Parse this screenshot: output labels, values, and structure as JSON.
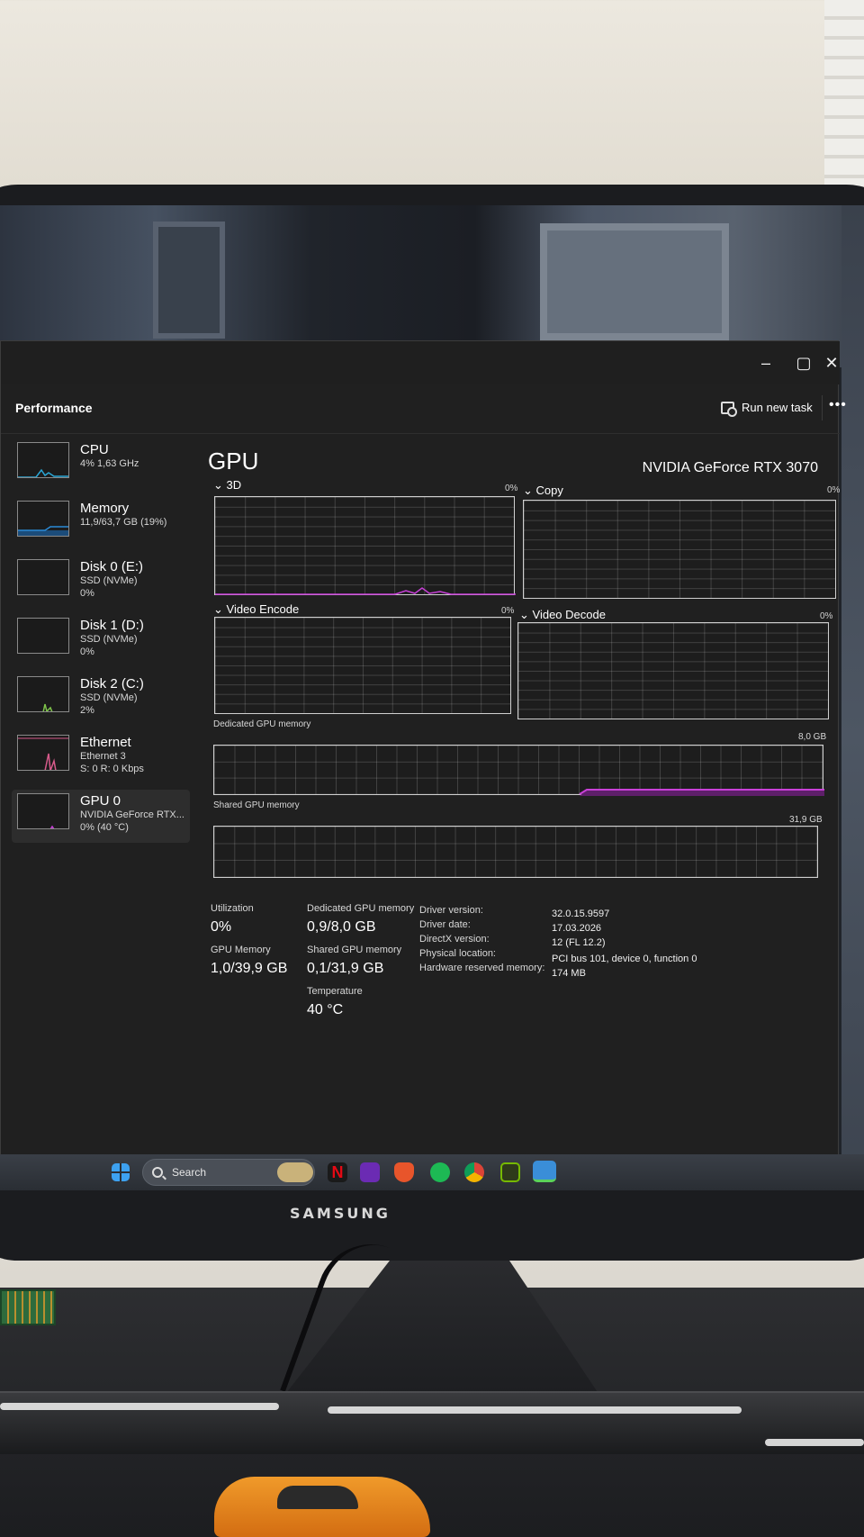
{
  "window": {
    "title": "Performance",
    "minimize": "–",
    "maximize": "▢",
    "close": "✕",
    "run_new_task": "Run new task",
    "more": "•••"
  },
  "sidebar": {
    "items": [
      {
        "name": "CPU",
        "sub1": "4% 1,63 GHz",
        "sub2": "",
        "sub3": "",
        "color": "#2aa7d6"
      },
      {
        "name": "Memory",
        "sub1": "11,9/63,7 GB (19%)",
        "sub2": "",
        "sub3": "",
        "color": "#2a8ad6"
      },
      {
        "name": "Disk 0 (E:)",
        "sub1": "SSD (NVMe)",
        "sub2": "0%",
        "sub3": "",
        "color": "#7ec34a"
      },
      {
        "name": "Disk 1 (D:)",
        "sub1": "SSD (NVMe)",
        "sub2": "0%",
        "sub3": "",
        "color": "#7ec34a"
      },
      {
        "name": "Disk 2 (C:)",
        "sub1": "SSD (NVMe)",
        "sub2": "2%",
        "sub3": "",
        "color": "#7ec34a"
      },
      {
        "name": "Ethernet",
        "sub1": "Ethernet 3",
        "sub2": "S: 0 R: 0 Kbps",
        "sub3": "",
        "color": "#d65a8a"
      },
      {
        "name": "GPU 0",
        "sub1": "NVIDIA GeForce RTX...",
        "sub2": "0% (40 °C)",
        "sub3": "",
        "color": "#c940d8"
      }
    ]
  },
  "main": {
    "title": "GPU",
    "model": "NVIDIA GeForce RTX 3070",
    "engines": [
      {
        "label": "3D",
        "pct": "0%"
      },
      {
        "label": "Copy",
        "pct": "0%"
      },
      {
        "label": "Video Encode",
        "pct": "0%"
      },
      {
        "label": "Video Decode",
        "pct": "0%"
      }
    ],
    "dedicated_label": "Dedicated GPU memory",
    "dedicated_max": "8,0 GB",
    "shared_label": "Shared GPU memory",
    "shared_max": "31,9 GB",
    "stats": {
      "utilization_label": "Utilization",
      "utilization": "0%",
      "gpu_memory_label": "GPU Memory",
      "gpu_memory": "1,0/39,9 GB",
      "dedicated_label": "Dedicated GPU memory",
      "dedicated": "0,9/8,0 GB",
      "shared_label": "Shared GPU memory",
      "shared": "0,1/31,9 GB",
      "temperature_label": "Temperature",
      "temperature": "40 °C"
    },
    "info": [
      {
        "label": "Driver version:",
        "value": "32.0.15.9597"
      },
      {
        "label": "Driver date:",
        "value": "17.03.2026"
      },
      {
        "label": "DirectX version:",
        "value": "12 (FL 12.2)"
      },
      {
        "label": "Physical location:",
        "value": "PCI bus 101, device 0, function 0"
      },
      {
        "label": "Hardware reserved memory:",
        "value": "174 MB"
      }
    ]
  },
  "taskbar": {
    "search": "Search",
    "icons": [
      {
        "name": "widgets",
        "color": "#c9b27a"
      },
      {
        "name": "netflix",
        "color": "#1a1a1a"
      },
      {
        "name": "next",
        "color": "#6b2bb3"
      },
      {
        "name": "brave",
        "color": "#e8552b"
      },
      {
        "name": "spotify",
        "color": "#1db954"
      },
      {
        "name": "chrome",
        "color": "#e0b020"
      },
      {
        "name": "nvidia",
        "color": "#76b900"
      },
      {
        "name": "task-manager",
        "color": "#3a8ed8"
      }
    ]
  },
  "monitor": {
    "brand": "SAMSUNG"
  }
}
